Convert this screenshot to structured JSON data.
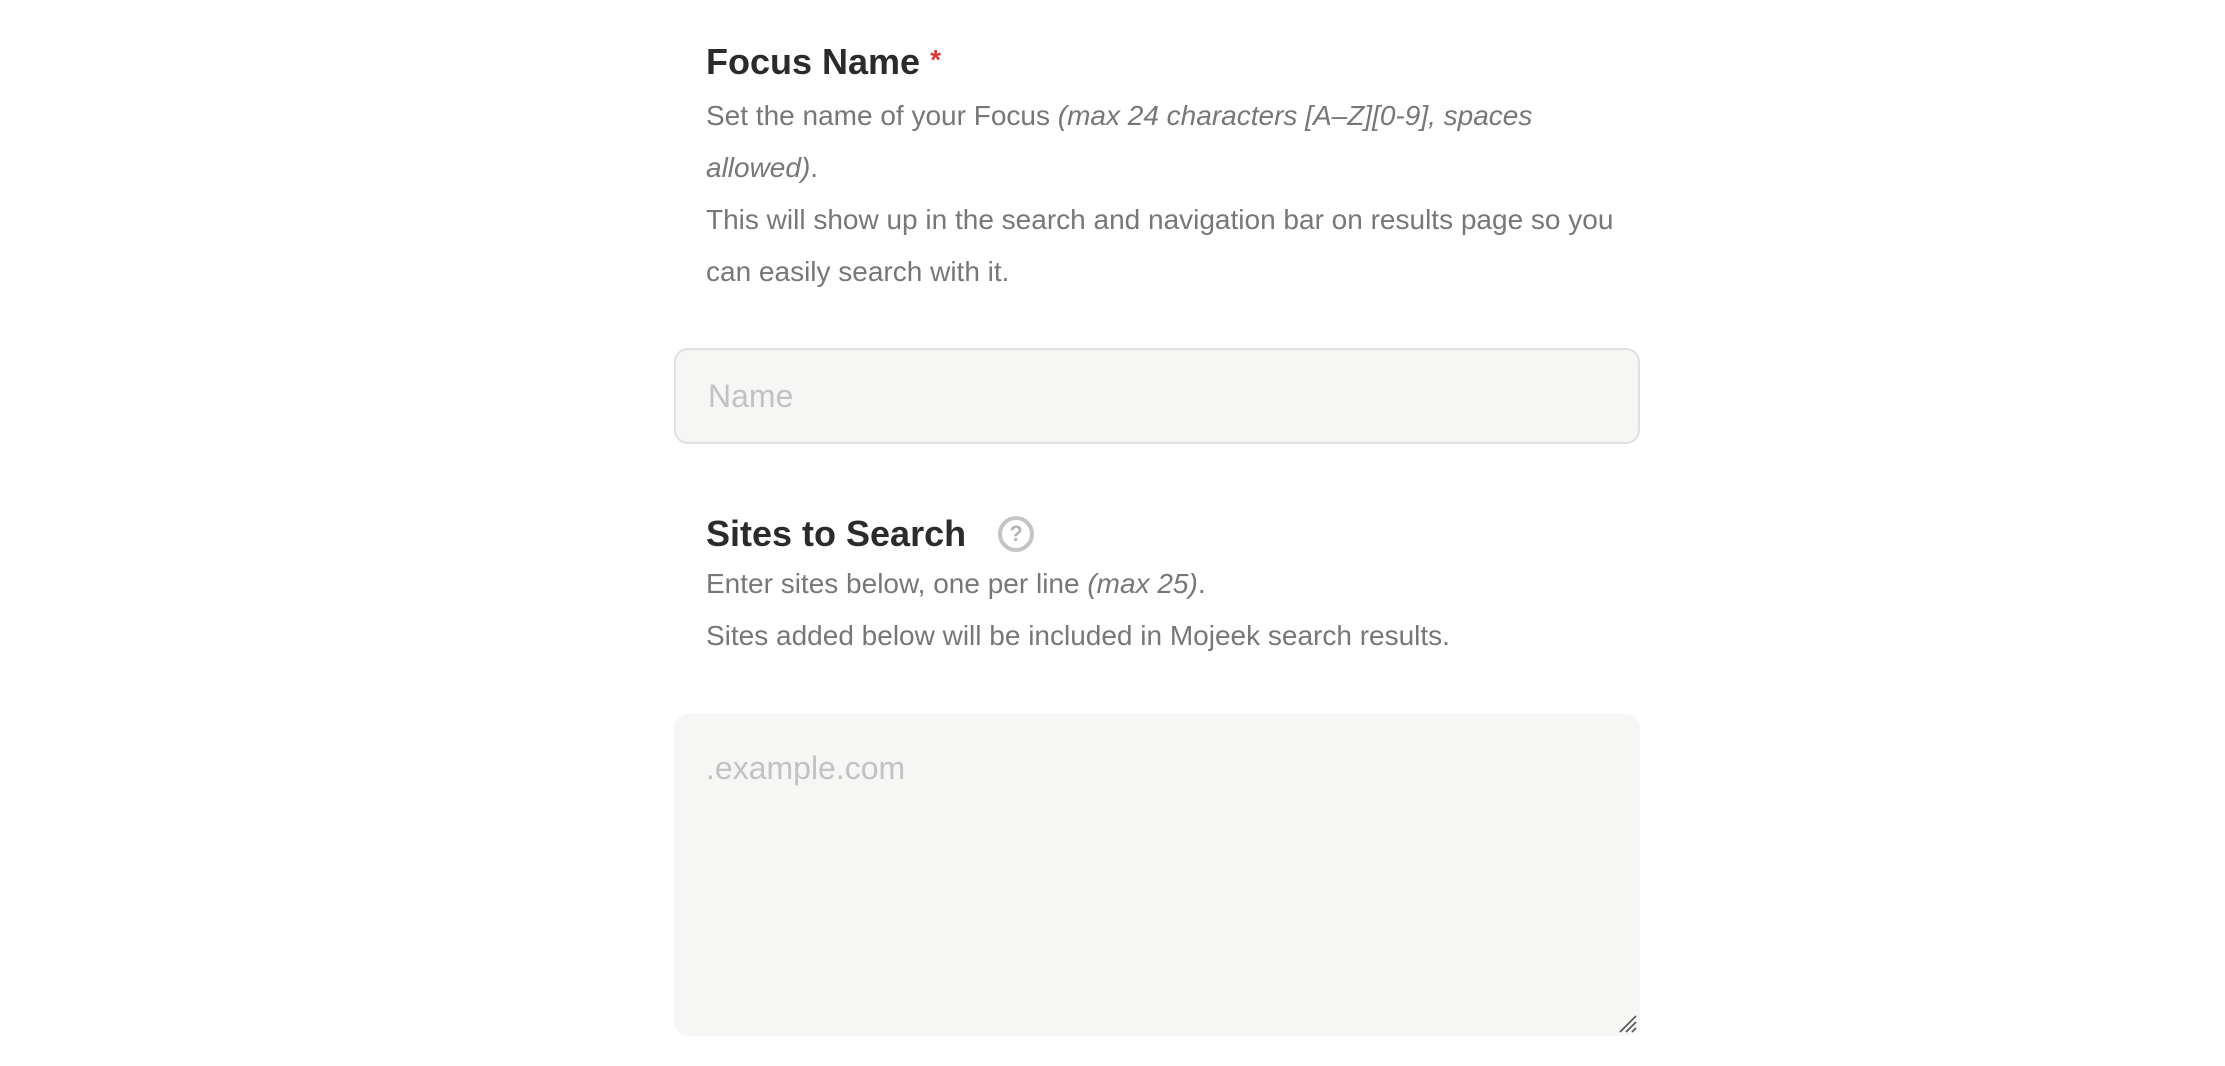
{
  "focus_name": {
    "label": "Focus Name",
    "required_mark": "*",
    "desc_line1_prefix": "Set the name of your Focus ",
    "desc_line1_italic": "(max 24 characters [A–Z][0-9], spaces allowed)",
    "desc_line1_suffix": ".",
    "desc_line2": "This will show up in the search and navigation bar on results page so you can easily search with it.",
    "input_placeholder": "Name",
    "input_value": ""
  },
  "sites": {
    "label": "Sites to Search",
    "help_glyph": "?",
    "desc_line1_prefix": "Enter sites below, one per line ",
    "desc_line1_italic": "(max 25)",
    "desc_line1_suffix": ".",
    "desc_line2": "Sites added below will be included in Mojeek search results.",
    "textarea_placeholder": ".example.com",
    "textarea_value": ""
  },
  "colors": {
    "required": "#d93a3a",
    "field_bg": "#f6f6f4",
    "muted_text": "#777777"
  }
}
